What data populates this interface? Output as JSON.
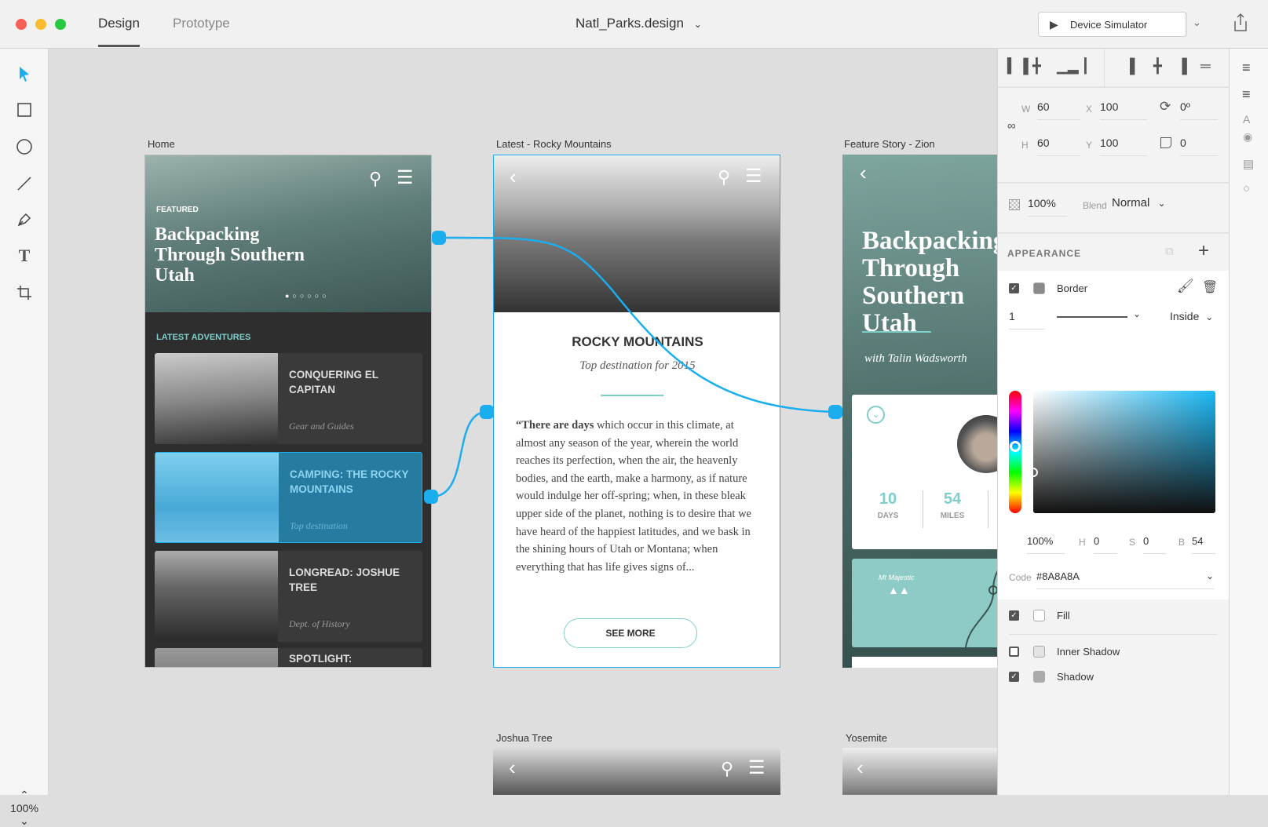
{
  "titlebar": {
    "tabs": [
      "Design",
      "Prototype"
    ],
    "active_tab": "Design",
    "document": "Natl_Parks.design",
    "simulator": "Device Simulator"
  },
  "canvas": {
    "zoom": "100%"
  },
  "artboards": {
    "home": {
      "label": "Home",
      "featured": "FEATURED",
      "hero_title": "Backpacking Through Southern Utah",
      "section": "LATEST ADVENTURES",
      "cards": [
        {
          "title": "CONQUERING EL CAPITAN",
          "subtitle": "Gear and Guides"
        },
        {
          "title": "CAMPING: THE ROCKY MOUNTAINS",
          "subtitle": "Top destination",
          "selected": true
        },
        {
          "title": "LONGREAD: JOSHUE TREE",
          "subtitle": "Dept. of History"
        },
        {
          "title": "SPOTLIGHT:",
          "subtitle": ""
        }
      ]
    },
    "latest": {
      "label": "Latest - Rocky Mountains",
      "title": "ROCKY MOUNTAINS",
      "subtitle": "Top destination for 2015",
      "quote_lead": "“There are days",
      "body": "which occur in this climate, at almost any season of the year, wherein the world reaches its perfection, when the air, the heavenly bodies, and the earth, make a harmony, as if nature would indulge her off-spring; when, in these bleak upper side of the planet, nothing is to desire that we have heard of the happiest latitudes, and we bask in the shining hours of Utah or Montana; when everything that has life gives signs of...",
      "button": "SEE MORE"
    },
    "feature": {
      "label": "Feature Story - Zion",
      "title": "Backpacking Through Southern Utah",
      "byline": "with Talin Wadsworth",
      "stats": [
        {
          "value": "10",
          "label": "DAYS"
        },
        {
          "value": "54",
          "label": "MILES"
        }
      ],
      "map_label": "Mt Majestic"
    },
    "joshua": {
      "label": "Joshua Tree"
    },
    "yosemite": {
      "label": "Yosemite"
    }
  },
  "inspector": {
    "w": "60",
    "h": "60",
    "x": "100",
    "y": "100",
    "rotation": "0º",
    "radius": "0",
    "opacity": "100%",
    "blend_label": "Blend",
    "blend": "Normal",
    "appearance_title": "APPEARANCE",
    "border": {
      "label": "Border",
      "checked": true,
      "width": "1",
      "position": "Inside"
    },
    "color": {
      "opacity": "100%",
      "h": "0",
      "s": "0",
      "b": "54",
      "code_label": "Code",
      "code": "#8A8A8A",
      "hue_fraction": 0.45
    },
    "fill": {
      "label": "Fill",
      "checked": true
    },
    "inner_shadow": {
      "label": "Inner Shadow",
      "checked": false
    },
    "shadow": {
      "label": "Shadow",
      "checked": true
    }
  },
  "colors": {
    "accent": "#1aaeef",
    "teal": "#7ecfcb",
    "dark": "#2e2e2e"
  }
}
